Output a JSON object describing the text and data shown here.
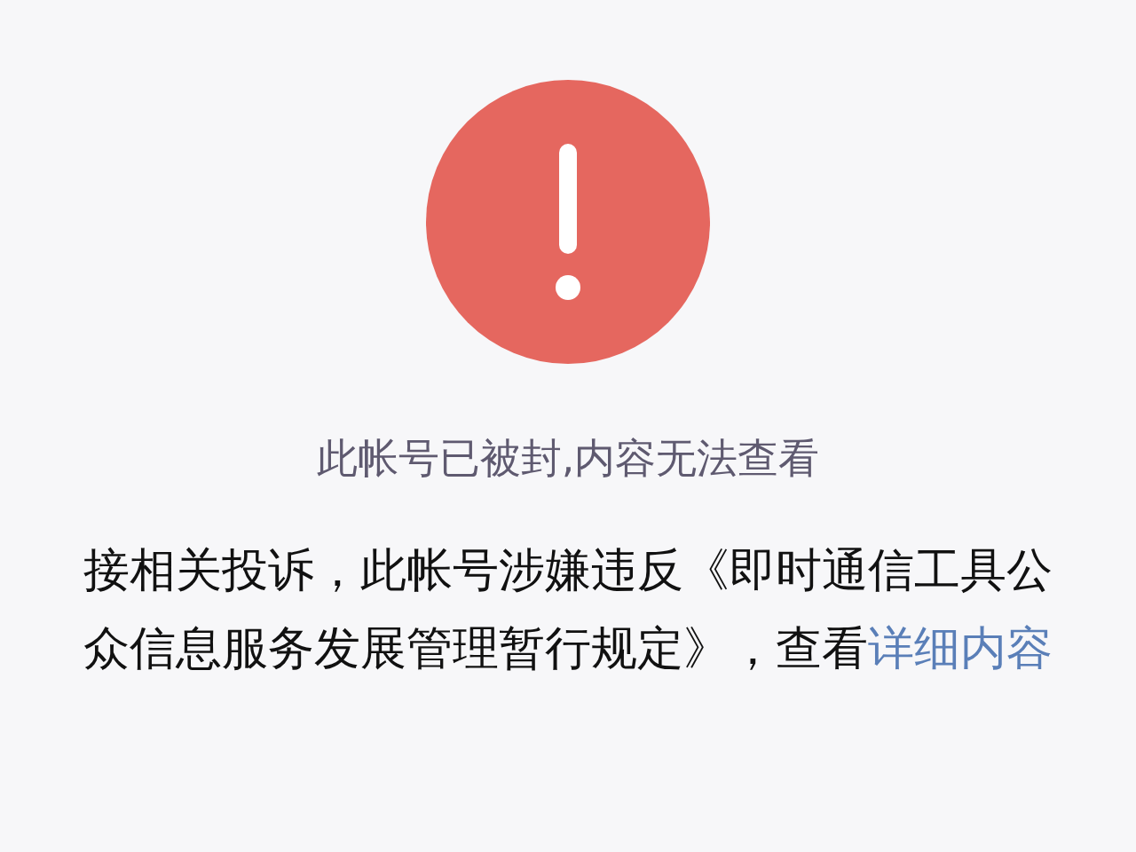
{
  "notice": {
    "title": "此帐号已被封,内容无法查看",
    "message": "接相关投诉，此帐号涉嫌违反《即时通信工具公众信息服务发展管理暂行规定》，查看",
    "link": "详细内容"
  }
}
